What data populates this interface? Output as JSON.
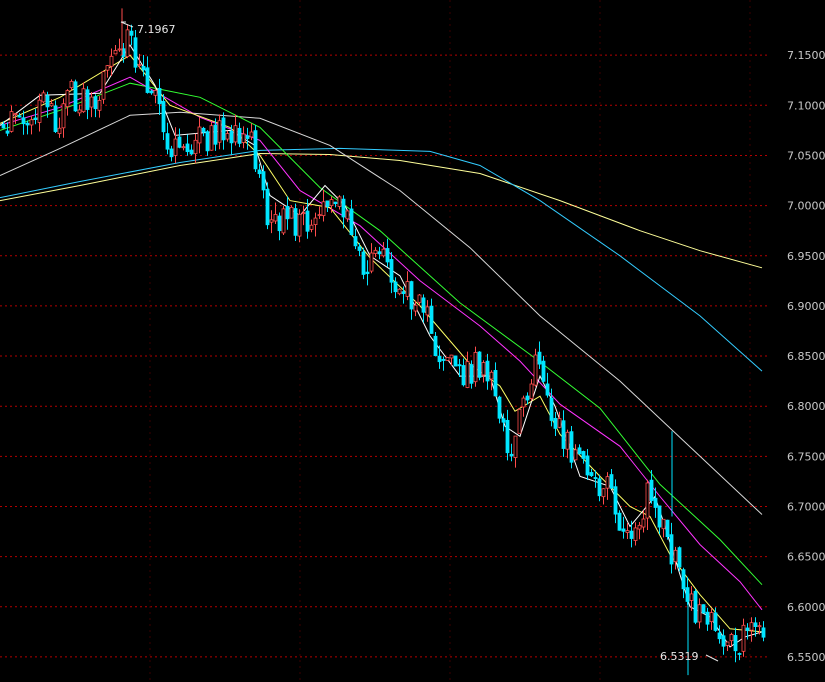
{
  "chart_data": {
    "type": "candlestick",
    "ylim": [
      6.525,
      7.205
    ],
    "y_ticks": [
      "7.1500",
      "7.1000",
      "7.0500",
      "7.0000",
      "6.9500",
      "6.9000",
      "6.8500",
      "6.8000",
      "6.7500",
      "6.7000",
      "6.6500",
      "6.6000",
      "6.5500"
    ],
    "grid": true,
    "colors": {
      "up": "#ff4d4d",
      "down": "#00e5ff",
      "ma5": "#ffffff",
      "ma10": "#ffff66",
      "ma20": "#ff33ff",
      "ma30": "#33ff33",
      "ma60": "#d8d8d8",
      "ma120": "#33ccff",
      "ma250": "#ffff99",
      "grid": "#b40000"
    },
    "annotations": {
      "high_label": "7.1967",
      "low_label": "6.5319"
    },
    "ma_series": [
      {
        "key": "ma250",
        "color": "#ffff99",
        "points": [
          [
            0,
            7.005
          ],
          [
            80,
            7.02
          ],
          [
            180,
            7.04
          ],
          [
            260,
            7.052
          ],
          [
            330,
            7.051
          ],
          [
            400,
            7.045
          ],
          [
            480,
            7.032
          ],
          [
            560,
            7.005
          ],
          [
            640,
            6.975
          ],
          [
            700,
            6.955
          ],
          [
            762,
            6.938
          ]
        ]
      },
      {
        "key": "ma120",
        "color": "#33ccff",
        "points": [
          [
            0,
            7.008
          ],
          [
            80,
            7.024
          ],
          [
            180,
            7.043
          ],
          [
            260,
            7.055
          ],
          [
            340,
            7.057
          ],
          [
            430,
            7.054
          ],
          [
            480,
            7.04
          ],
          [
            540,
            7.005
          ],
          [
            620,
            6.95
          ],
          [
            700,
            6.89
          ],
          [
            762,
            6.835
          ]
        ]
      },
      {
        "key": "ma60",
        "color": "#d8d8d8",
        "points": [
          [
            0,
            7.03
          ],
          [
            60,
            7.057
          ],
          [
            130,
            7.09
          ],
          [
            180,
            7.093
          ],
          [
            260,
            7.087
          ],
          [
            330,
            7.06
          ],
          [
            400,
            7.015
          ],
          [
            470,
            6.958
          ],
          [
            540,
            6.89
          ],
          [
            620,
            6.825
          ],
          [
            700,
            6.75
          ],
          [
            762,
            6.692
          ]
        ]
      },
      {
        "key": "ma30",
        "color": "#33ff33",
        "points": [
          [
            0,
            7.075
          ],
          [
            60,
            7.095
          ],
          [
            130,
            7.122
          ],
          [
            200,
            7.108
          ],
          [
            260,
            7.078
          ],
          [
            320,
            7.018
          ],
          [
            380,
            6.975
          ],
          [
            460,
            6.903
          ],
          [
            535,
            6.848
          ],
          [
            600,
            6.798
          ],
          [
            660,
            6.722
          ],
          [
            720,
            6.667
          ],
          [
            762,
            6.622
          ]
        ]
      },
      {
        "key": "ma20",
        "color": "#ff33ff",
        "points": [
          [
            0,
            7.08
          ],
          [
            60,
            7.098
          ],
          [
            130,
            7.128
          ],
          [
            200,
            7.088
          ],
          [
            260,
            7.065
          ],
          [
            300,
            7.015
          ],
          [
            360,
            6.98
          ],
          [
            420,
            6.925
          ],
          [
            480,
            6.88
          ],
          [
            520,
            6.845
          ],
          [
            560,
            6.802
          ],
          [
            620,
            6.76
          ],
          [
            660,
            6.71
          ],
          [
            700,
            6.662
          ],
          [
            740,
            6.625
          ],
          [
            762,
            6.597
          ]
        ]
      },
      {
        "key": "ma10",
        "color": "#ffff66",
        "points": [
          [
            0,
            7.082
          ],
          [
            60,
            7.108
          ],
          [
            130,
            7.15
          ],
          [
            170,
            7.1
          ],
          [
            230,
            7.078
          ],
          [
            260,
            7.05
          ],
          [
            290,
            7.005
          ],
          [
            330,
            6.998
          ],
          [
            370,
            6.948
          ],
          [
            420,
            6.9
          ],
          [
            470,
            6.842
          ],
          [
            500,
            6.82
          ],
          [
            515,
            6.795
          ],
          [
            540,
            6.81
          ],
          [
            560,
            6.772
          ],
          [
            600,
            6.73
          ],
          [
            630,
            6.7
          ],
          [
            650,
            6.69
          ],
          [
            670,
            6.652
          ],
          [
            700,
            6.612
          ],
          [
            730,
            6.578
          ],
          [
            762,
            6.575
          ]
        ]
      },
      {
        "key": "ma5",
        "color": "#ffffff",
        "points": [
          [
            0,
            7.08
          ],
          [
            40,
            7.11
          ],
          [
            100,
            7.112
          ],
          [
            130,
            7.16
          ],
          [
            155,
            7.12
          ],
          [
            175,
            7.07
          ],
          [
            230,
            7.075
          ],
          [
            255,
            7.06
          ],
          [
            270,
            7.01
          ],
          [
            300,
            6.99
          ],
          [
            325,
            7.02
          ],
          [
            345,
            7.0
          ],
          [
            370,
            6.95
          ],
          [
            400,
            6.93
          ],
          [
            430,
            6.87
          ],
          [
            460,
            6.83
          ],
          [
            490,
            6.83
          ],
          [
            505,
            6.78
          ],
          [
            520,
            6.77
          ],
          [
            540,
            6.83
          ],
          [
            555,
            6.8
          ],
          [
            580,
            6.73
          ],
          [
            610,
            6.72
          ],
          [
            630,
            6.68
          ],
          [
            655,
            6.71
          ],
          [
            665,
            6.68
          ],
          [
            690,
            6.6
          ],
          [
            710,
            6.59
          ],
          [
            730,
            6.56
          ],
          [
            745,
            6.57
          ],
          [
            762,
            6.575
          ]
        ]
      }
    ],
    "anchors": [
      [
        0,
        7.08
      ],
      [
        20,
        7.09
      ],
      [
        40,
        7.1
      ],
      [
        55,
        7.085
      ],
      [
        70,
        7.11
      ],
      [
        90,
        7.105
      ],
      [
        110,
        7.135
      ],
      [
        125,
        7.17
      ],
      [
        135,
        7.14
      ],
      [
        155,
        7.1
      ],
      [
        165,
        7.06
      ],
      [
        200,
        7.065
      ],
      [
        230,
        7.075
      ],
      [
        250,
        7.07
      ],
      [
        258,
        7.03
      ],
      [
        265,
        6.99
      ],
      [
        290,
        6.985
      ],
      [
        310,
        6.975
      ],
      [
        325,
        7.015
      ],
      [
        340,
        6.995
      ],
      [
        360,
        6.945
      ],
      [
        380,
        6.95
      ],
      [
        400,
        6.92
      ],
      [
        420,
        6.9
      ],
      [
        440,
        6.85
      ],
      [
        455,
        6.83
      ],
      [
        475,
        6.84
      ],
      [
        490,
        6.83
      ],
      [
        500,
        6.78
      ],
      [
        510,
        6.752
      ],
      [
        520,
        6.79
      ],
      [
        535,
        6.84
      ],
      [
        545,
        6.81
      ],
      [
        560,
        6.77
      ],
      [
        575,
        6.75
      ],
      [
        590,
        6.72
      ],
      [
        605,
        6.73
      ],
      [
        615,
        6.69
      ],
      [
        630,
        6.66
      ],
      [
        645,
        6.71
      ],
      [
        660,
        6.69
      ],
      [
        675,
        6.64
      ],
      [
        690,
        6.6
      ],
      [
        705,
        6.59
      ],
      [
        720,
        6.56
      ],
      [
        735,
        6.565
      ],
      [
        750,
        6.575
      ],
      [
        762,
        6.575
      ]
    ]
  }
}
